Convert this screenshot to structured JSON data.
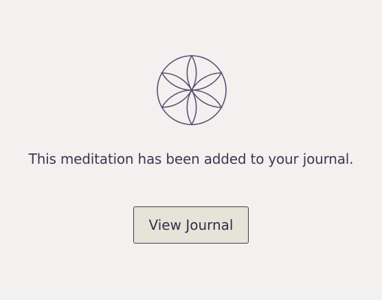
{
  "logo": {
    "icon": "flower-of-life-icon",
    "color": "#5a4f73"
  },
  "message": "This meditation has been added to your journal.",
  "button": {
    "label": "View Journal"
  },
  "colors": {
    "background": "#f2f1f0",
    "text": "#3b3552",
    "button_bg": "#e6e3d9",
    "button_border": "#3f3b4c"
  }
}
